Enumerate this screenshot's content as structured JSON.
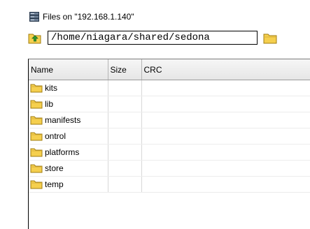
{
  "header": {
    "icon": "server-icon",
    "title": "Files on \"192.168.1.140\""
  },
  "pathbar": {
    "up_icon": "folder-up-icon",
    "path_value": "/home/niagara/shared/sedona",
    "browse_icon": "folder-icon"
  },
  "table": {
    "columns": [
      "Name",
      "Size",
      "CRC"
    ],
    "rows": [
      {
        "name": "kits",
        "size": "",
        "crc": ""
      },
      {
        "name": "lib",
        "size": "",
        "crc": ""
      },
      {
        "name": "manifests",
        "size": "",
        "crc": ""
      },
      {
        "name": "ontrol",
        "size": "",
        "crc": ""
      },
      {
        "name": "platforms",
        "size": "",
        "crc": ""
      },
      {
        "name": "store",
        "size": "",
        "crc": ""
      },
      {
        "name": "temp",
        "size": "",
        "crc": ""
      }
    ]
  },
  "colors": {
    "folder_fill": "#f5cf4e",
    "folder_stroke": "#a07c10",
    "up_arrow": "#2e9a2e"
  }
}
